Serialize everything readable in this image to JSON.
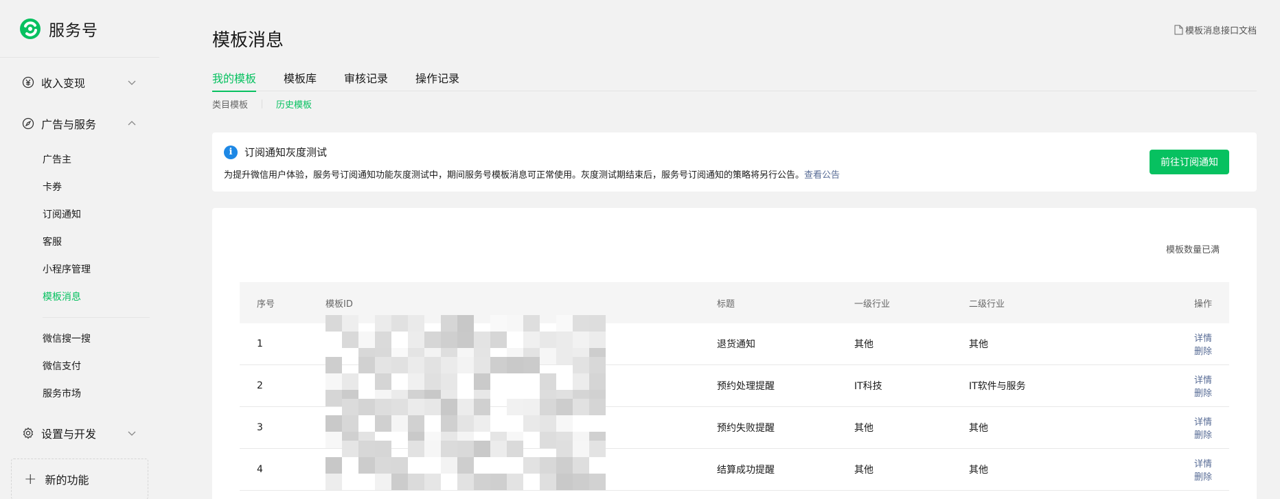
{
  "brand": {
    "name": "服务号"
  },
  "sidebar": {
    "groups": [
      {
        "label": "收入变现",
        "expanded": false
      },
      {
        "label": "广告与服务",
        "expanded": true,
        "items": [
          "广告主",
          "卡券",
          "订阅通知",
          "客服",
          "小程序管理",
          "模板消息"
        ],
        "items2": [
          "微信搜一搜",
          "微信支付",
          "服务市场"
        ]
      },
      {
        "label": "设置与开发",
        "expanded": false
      }
    ],
    "active_item": "模板消息",
    "new_feature": "新的功能"
  },
  "header": {
    "title": "模板消息",
    "doc_link": "模板消息接口文档"
  },
  "tabs": [
    "我的模板",
    "模板库",
    "审核记录",
    "操作记录"
  ],
  "active_tab": "我的模板",
  "subtabs": [
    "类目模板",
    "历史模板"
  ],
  "active_subtab": "历史模板",
  "notice": {
    "title": "订阅通知灰度测试",
    "text": "为提升微信用户体验，服务号订阅通知功能灰度测试中，期间服务号模板消息可正常使用。灰度测试期结束后，服务号订阅通知的策略将另行公告。",
    "link": "查看公告",
    "button": "前往订阅通知"
  },
  "quota_text": "模板数量已满",
  "table": {
    "headers": [
      "序号",
      "模板ID",
      "标题",
      "一级行业",
      "二级行业",
      "操作"
    ],
    "rows": [
      {
        "idx": "1",
        "title": "退货通知",
        "ind1": "其他",
        "ind2": "其他"
      },
      {
        "idx": "2",
        "title": "预约处理提醒",
        "ind1": "IT科技",
        "ind2": "IT软件与服务"
      },
      {
        "idx": "3",
        "title": "预约失败提醒",
        "ind1": "其他",
        "ind2": "其他"
      },
      {
        "idx": "4",
        "title": "结算成功提醒",
        "ind1": "其他",
        "ind2": "其他"
      }
    ],
    "op_detail": "详情",
    "op_delete": "删除"
  },
  "colors": {
    "accent": "#07c160",
    "link": "#576b95",
    "info": "#1e88e5"
  },
  "icons": [
    "logo-icon",
    "yuan-icon",
    "compass-icon",
    "gear-icon",
    "chevron-down-icon",
    "chevron-up-icon",
    "document-icon",
    "info-icon",
    "plus-icon"
  ]
}
